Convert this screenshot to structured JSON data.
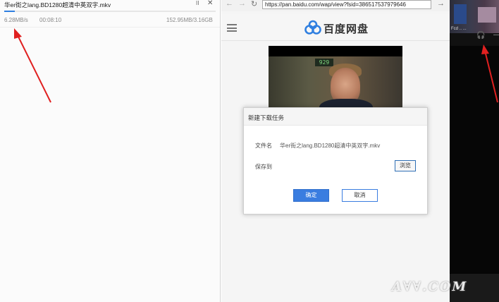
{
  "download": {
    "filename": "华er街之lang.BD1280超清中英双字.mkv",
    "speed": "6.28MB/s",
    "time": "00:08:10",
    "size": "152.95MB/3.16GB",
    "progress_percent": 5,
    "pause_glyph": "II",
    "close_glyph": "✕"
  },
  "browser": {
    "url": "https://pan.baidu.com/wap/view?fsid=386517537979646",
    "back_glyph": "←",
    "forward_glyph": "→",
    "reload_glyph": "↻",
    "go_glyph": "→"
  },
  "site": {
    "name": "百度网盘",
    "brand_color": "#2f7fe0"
  },
  "video": {
    "clock": "929"
  },
  "dialog": {
    "title": "新建下载任务",
    "filename_label": "文件名",
    "filename_value": "华er街之lang.BD1280超清中英双字.mkv",
    "save_to_label": "保存到",
    "browse_label": "浏览",
    "ok_label": "确定",
    "cancel_label": "取消"
  },
  "right": {
    "desktop_text": "Fcd  ..  ...",
    "dash_glyph": "—",
    "headset_glyph": "🎧"
  },
  "watermark": "A∀∀.COM"
}
